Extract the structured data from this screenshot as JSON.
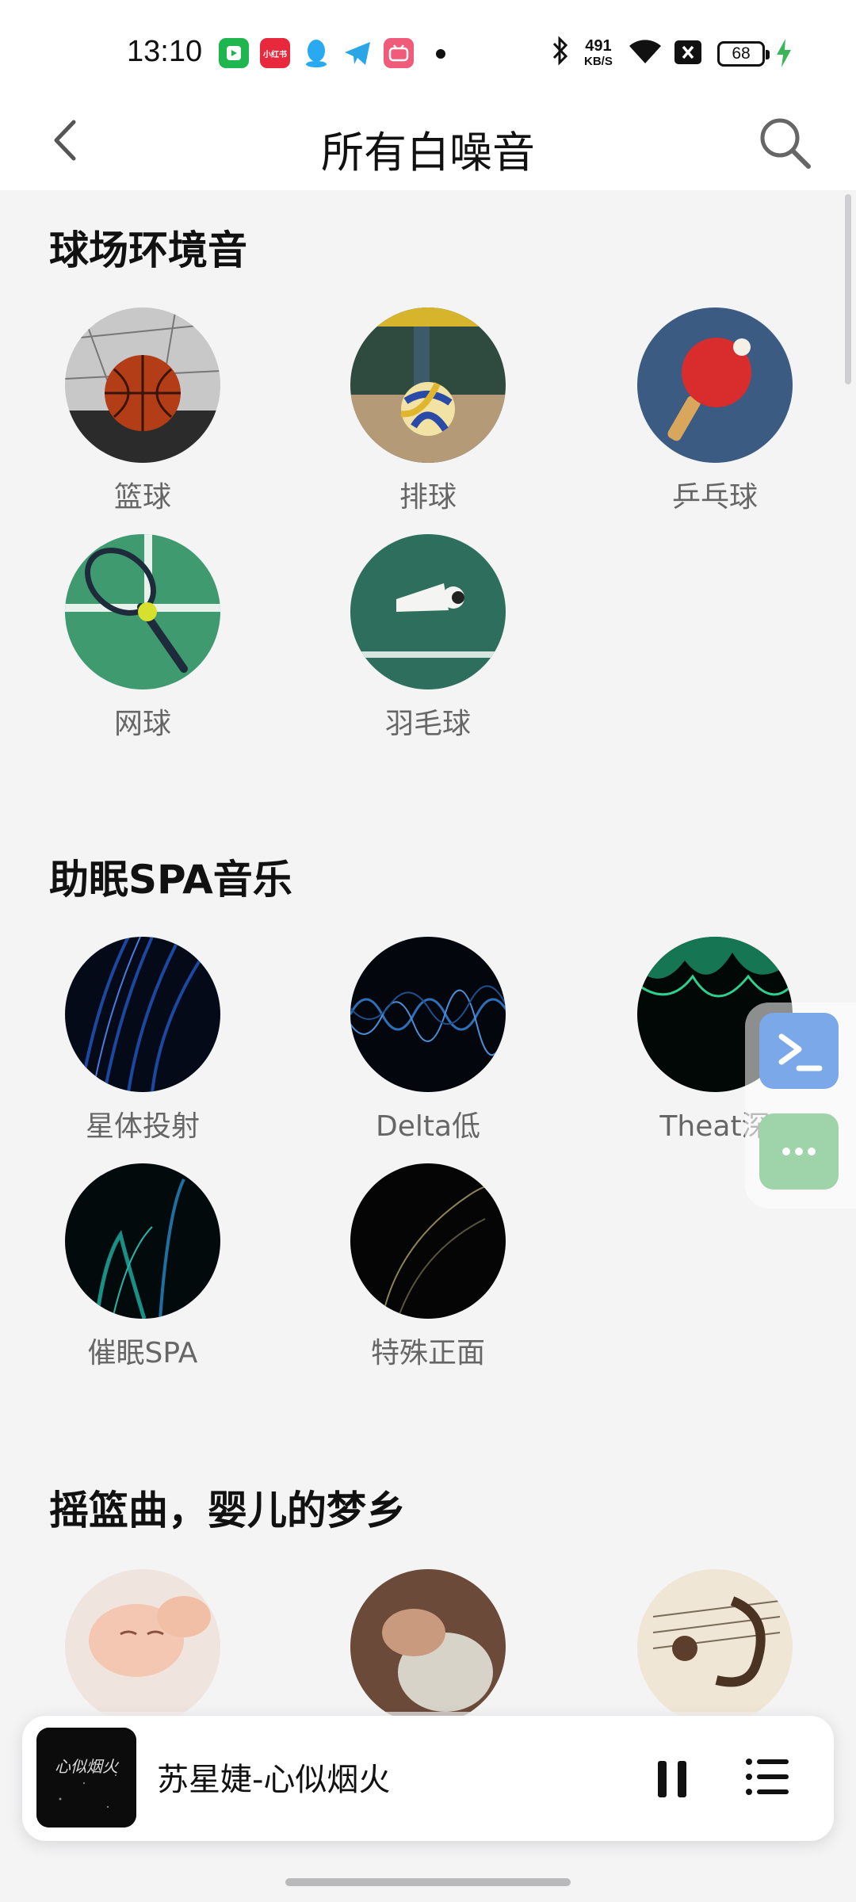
{
  "status_bar": {
    "time": "13:10",
    "net_speed": "491",
    "net_unit": "KB/S",
    "battery": "68",
    "icons": [
      "app-green-icon",
      "xiaohongshu-icon",
      "qq-icon",
      "telegram-icon",
      "app-pink-icon",
      "bluetooth-icon",
      "wifi-icon",
      "sim-off-icon",
      "battery-icon",
      "charging-icon"
    ]
  },
  "header": {
    "title": "所有白噪音",
    "back_icon": "chevron-left-icon",
    "search_icon": "search-icon"
  },
  "sections": [
    {
      "title": "球场环境音",
      "items": [
        {
          "label": "篮球"
        },
        {
          "label": "排球"
        },
        {
          "label": "乒乓球"
        },
        {
          "label": "网球"
        },
        {
          "label": "羽毛球"
        }
      ]
    },
    {
      "title": "助眠SPA音乐",
      "items": [
        {
          "label": "星体投射"
        },
        {
          "label": "Delta低"
        },
        {
          "label": "Theat深"
        },
        {
          "label": "催眠SPA"
        },
        {
          "label": "特殊正面"
        }
      ]
    },
    {
      "title": "摇篮曲，婴儿的梦乡",
      "items": [
        {
          "label": ""
        },
        {
          "label": ""
        },
        {
          "label": ""
        }
      ]
    }
  ],
  "floating": {
    "terminal_icon": "terminal-icon",
    "more_icon": "more-dots-icon"
  },
  "player": {
    "title": "苏星婕-心似烟火",
    "cover_text": "心似烟火",
    "pause_icon": "pause-icon",
    "playlist_icon": "playlist-icon"
  },
  "colors": {
    "background": "#f4f4f5",
    "terminal_button": "#7aa8e8",
    "more_button": "#9fd3a9"
  }
}
